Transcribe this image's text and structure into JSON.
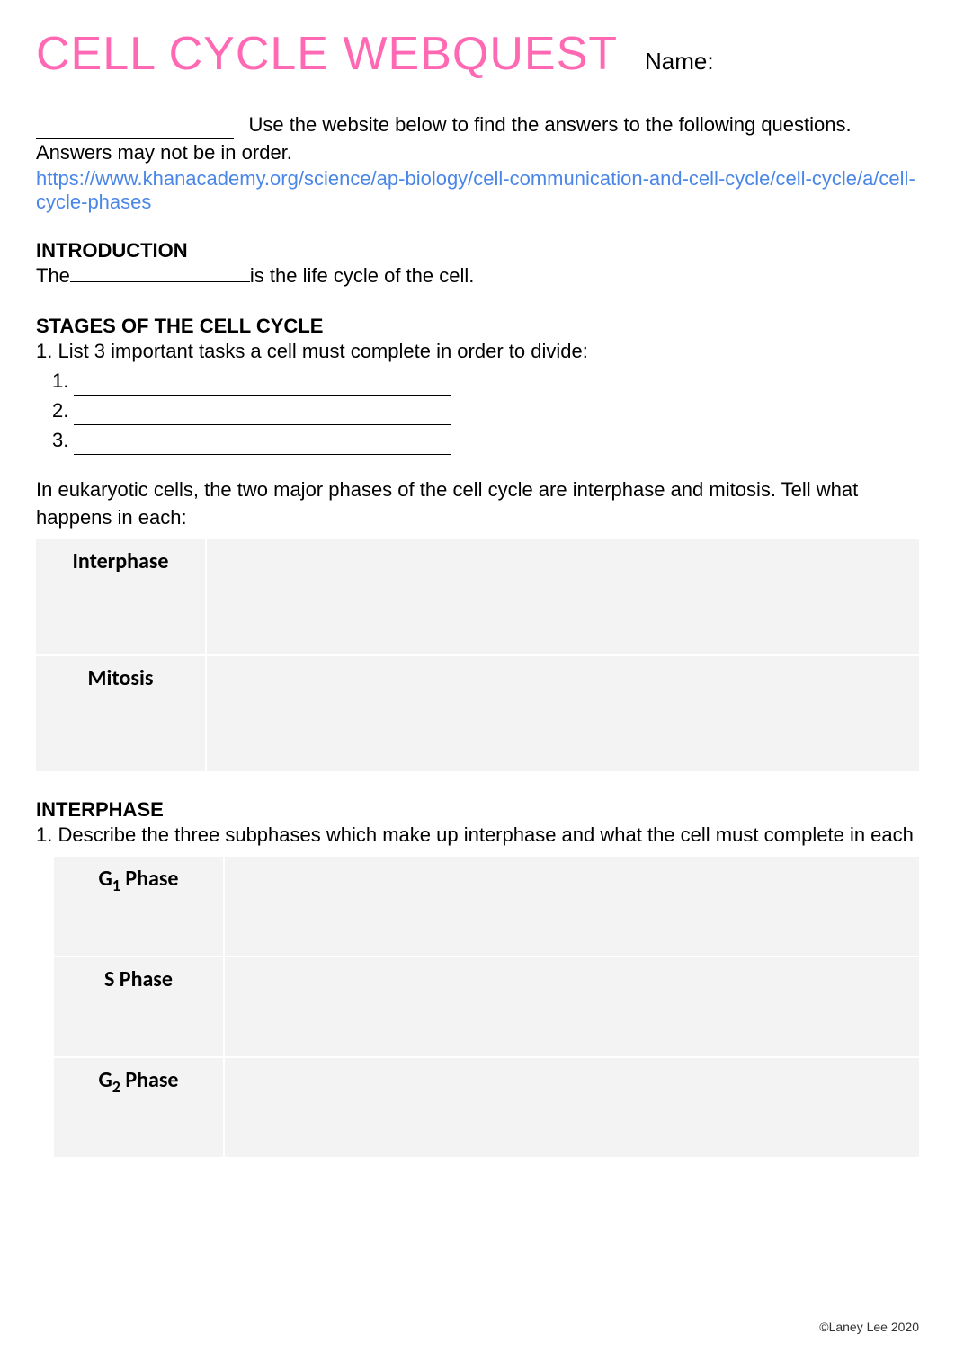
{
  "header": {
    "title": "CELL CYCLE WEBQUEST",
    "name_label": "Name:"
  },
  "instructions": {
    "line1": "Use the website below to find the answers to the following questions.",
    "line2": "Answers may not be in order.",
    "link": "https://www.khanacademy.org/science/ap-biology/cell-communication-and-cell-cycle/cell-cycle/a/cell-cycle-phases"
  },
  "introduction": {
    "heading": "INTRODUCTION",
    "prefix": "The ",
    "suffix": " is the life cycle of the cell."
  },
  "stages": {
    "heading": "STAGES OF THE CELL CYCLE",
    "q1": "1. List 3 important tasks a cell must complete in order to divide:",
    "items": [
      "1.",
      "2.",
      "3."
    ],
    "q2": "In eukaryotic cells, the two major phases of the cell cycle are interphase and mitosis. Tell what happens in each:",
    "table": [
      {
        "label": "Interphase"
      },
      {
        "label": "Mitosis"
      }
    ]
  },
  "interphase": {
    "heading": "INTERPHASE",
    "q1": "1. Describe the three subphases which make up interphase and what the cell must complete in each",
    "table": [
      {
        "label_html": "G₁ Phase"
      },
      {
        "label_html": "S Phase"
      },
      {
        "label_html": "G₂ Phase"
      }
    ]
  },
  "footer": {
    "copyright": "©Laney Lee 2020"
  }
}
